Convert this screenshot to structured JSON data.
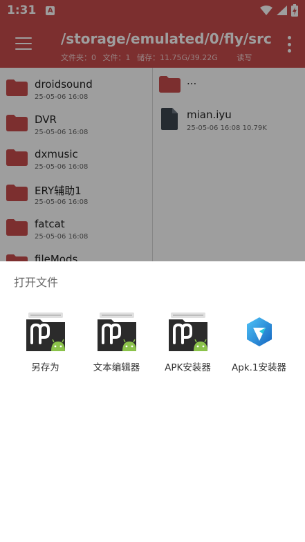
{
  "status": {
    "time": "1:31",
    "notif_letter": "A"
  },
  "appbar": {
    "path": "/storage/emulated/0/fly/src",
    "folders_label": "文件夹：0",
    "files_label": "文件：1",
    "storage_label": "储存：11.75G/39.22G",
    "mode": "读写"
  },
  "left_pane": {
    "items": [
      {
        "name": "droidsound",
        "date": "25-05-06 16:08"
      },
      {
        "name": "DVR",
        "date": "25-05-06 16:08"
      },
      {
        "name": "dxmusic",
        "date": "25-05-06 16:08"
      },
      {
        "name": "ERY辅助1",
        "date": "25-05-06 16:08"
      },
      {
        "name": "fatcat",
        "date": "25-05-06 16:08"
      },
      {
        "name": "fileMods",
        "date": ""
      }
    ]
  },
  "right_pane": {
    "parent": "...",
    "file": {
      "name": "mian.iyu",
      "date": "25-05-06 16:08",
      "size": "10.79K"
    }
  },
  "sheet": {
    "title": "打开文件",
    "apps": [
      {
        "label": "另存为",
        "icon": "mt-manager-icon"
      },
      {
        "label": "文本编辑器",
        "icon": "mt-manager-icon"
      },
      {
        "label": "APK安装器",
        "icon": "mt-manager-icon"
      },
      {
        "label": "Apk.1安装器",
        "icon": "apk-installer-icon"
      }
    ]
  },
  "colors": {
    "primary": "#c94c4c",
    "folder": "#c94c4c",
    "file": "#3d4650",
    "android": "#8bc34a"
  }
}
